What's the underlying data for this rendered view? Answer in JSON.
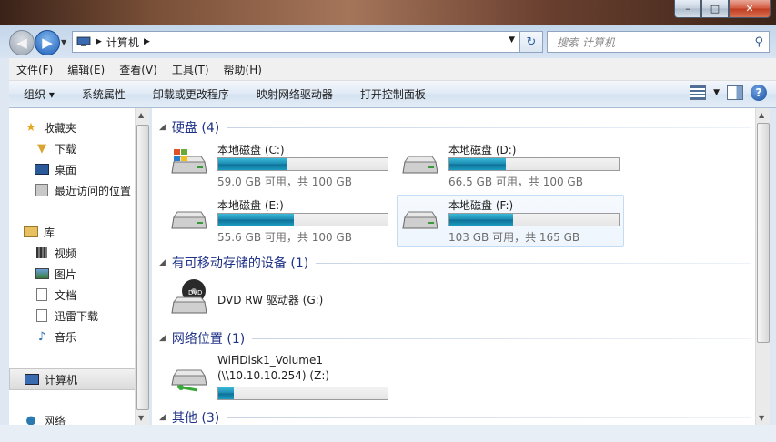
{
  "window": {
    "caption": {
      "minimize": "–",
      "maximize": "□",
      "close": "✕"
    }
  },
  "address": {
    "path": [
      "计算机"
    ],
    "search_placeholder": "搜索 计算机"
  },
  "menu": [
    "文件(F)",
    "编辑(E)",
    "查看(V)",
    "工具(T)",
    "帮助(H)"
  ],
  "commands": [
    "组织 ▾",
    "系统属性",
    "卸载或更改程序",
    "映射网络驱动器",
    "打开控制面板"
  ],
  "nav": {
    "favorites": {
      "label": "收藏夹",
      "items": [
        "下载",
        "桌面",
        "最近访问的位置"
      ]
    },
    "libraries": {
      "label": "库",
      "items": [
        "视频",
        "图片",
        "文档",
        "迅雷下载",
        "音乐"
      ]
    },
    "computer": "计算机",
    "network": "网络"
  },
  "groups": {
    "hard_disks": "硬盘 (4)",
    "removable": "有可移动存储的设备 (1)",
    "network_location": "网络位置 (1)",
    "other": "其他 (3)"
  },
  "drives": [
    {
      "name": "本地磁盘 (C:)",
      "size": "59.0 GB 可用，共 100 GB",
      "used_fraction": 0.41
    },
    {
      "name": "本地磁盘 (D:)",
      "size": "66.5 GB 可用，共 100 GB",
      "used_fraction": 0.335
    },
    {
      "name": "本地磁盘 (E:)",
      "size": "55.6 GB 可用，共 100 GB",
      "used_fraction": 0.444
    },
    {
      "name": "本地磁盘 (F:)",
      "size": "103 GB 可用，共 165 GB",
      "used_fraction": 0.376
    }
  ],
  "dvd": {
    "name": "DVD RW 驱动器 (G:)",
    "badge": "DVD"
  },
  "netdrive": {
    "name": "WiFiDisk1_Volume1",
    "sub": "(\\\\10.10.10.254) (Z:)",
    "used_fraction": 0.09
  },
  "colors": {
    "accent": "#1e3287",
    "bar": "#1a8ab0"
  }
}
